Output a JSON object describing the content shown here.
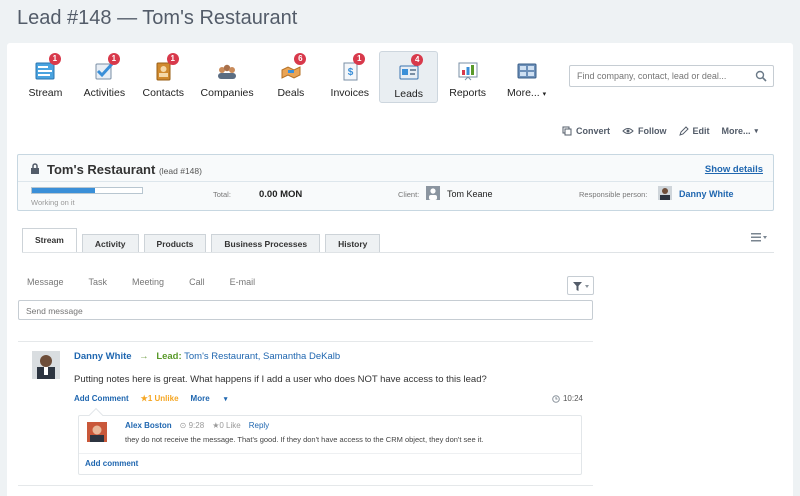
{
  "page": {
    "title": "Lead #148 — Tom's Restaurant"
  },
  "nav": {
    "items": [
      {
        "label": "Stream",
        "badge": "1",
        "icon": "stream-icon"
      },
      {
        "label": "Activities",
        "badge": "1",
        "icon": "activities-icon"
      },
      {
        "label": "Contacts",
        "badge": "1",
        "icon": "contacts-icon"
      },
      {
        "label": "Companies",
        "badge": "",
        "icon": "companies-icon"
      },
      {
        "label": "Deals",
        "badge": "6",
        "icon": "deals-icon"
      },
      {
        "label": "Invoices",
        "badge": "1",
        "icon": "invoices-icon"
      },
      {
        "label": "Leads",
        "badge": "4",
        "icon": "leads-icon"
      },
      {
        "label": "Reports",
        "badge": "",
        "icon": "reports-icon"
      },
      {
        "label": "More...",
        "badge": "",
        "icon": "more-icon"
      }
    ],
    "active": "Leads"
  },
  "search": {
    "placeholder": "Find company, contact, lead or deal..."
  },
  "actions": {
    "convert": "Convert",
    "follow": "Follow",
    "edit": "Edit",
    "more": "More..."
  },
  "lead": {
    "name": "Tom's Restaurant",
    "id_label": "(lead #148)",
    "show_details": "Show details",
    "status": "Working on it",
    "progress": 0.57,
    "total_label": "Total:",
    "total_value": "0.00 MON",
    "client_label": "Client:",
    "client_value": "Tom Keane",
    "responsible_label": "Responsible person:",
    "responsible_value": "Danny White"
  },
  "tabs": [
    "Stream",
    "Activity",
    "Products",
    "Business Processes",
    "History"
  ],
  "composer": {
    "tabs": [
      "Message",
      "Task",
      "Meeting",
      "Call",
      "E-mail"
    ],
    "placeholder": "Send message"
  },
  "post": {
    "author": "Danny White",
    "lead_label": "Lead:",
    "lead_link": "Tom's Restaurant, Samantha DeKalb",
    "text": "Putting notes here is great. What happens if I add a user who does NOT have access to this lead?",
    "add_comment": "Add Comment",
    "likes": "★1 Unlike",
    "more": "More",
    "time": "10:24",
    "comment": {
      "author": "Alex Boston",
      "time": "9:28",
      "likes": "★0 Like",
      "reply": "Reply",
      "text": "they do not receive the message. That's good. If they don't have access to the CRM object, they don't see it."
    },
    "add_comment2": "Add comment"
  },
  "colors": {
    "accent": "#2067b0",
    "badge": "#d8394b",
    "progress": "#3a8fd8",
    "lead_green": "#5a9a2a"
  }
}
